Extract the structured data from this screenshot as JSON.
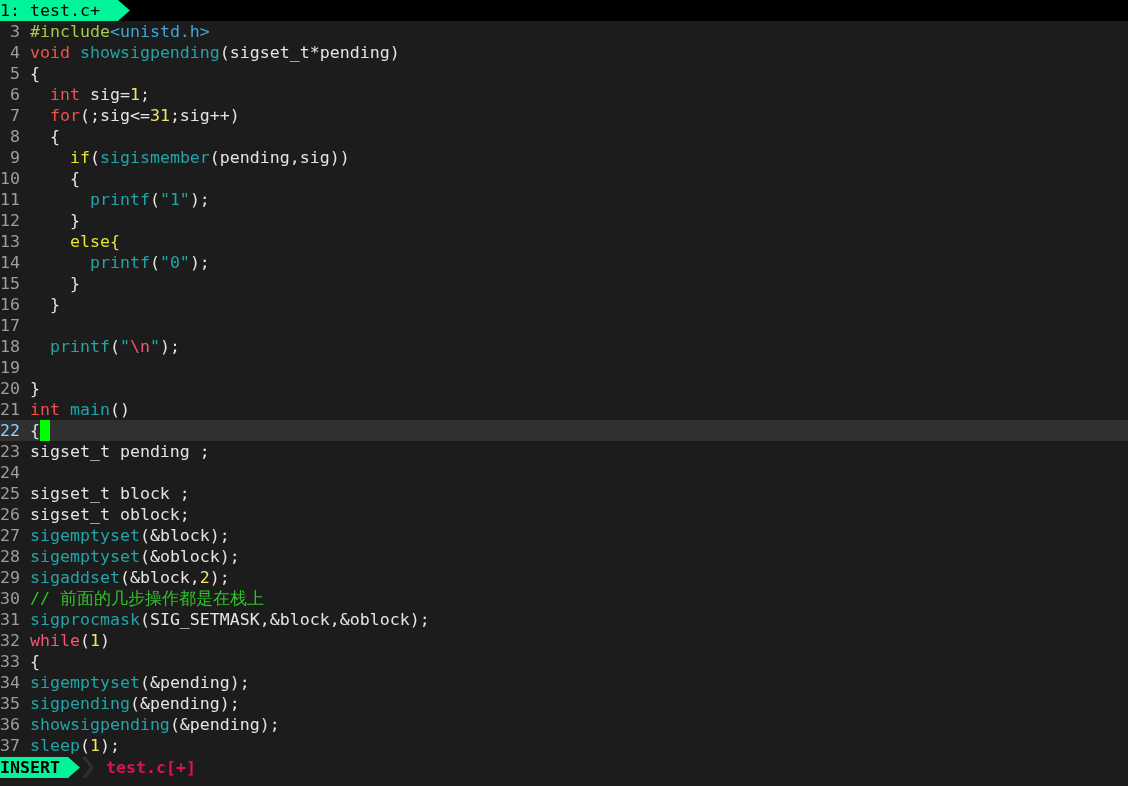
{
  "tabline": {
    "tabs": [
      {
        "label": "1: test.c+",
        "selected": true
      }
    ]
  },
  "lines": [
    {
      "number": "3",
      "current": false,
      "segments": [
        {
          "kind": "preproc",
          "text": "#include"
        },
        {
          "kind": "include",
          "text": "<unistd.h>"
        }
      ]
    },
    {
      "number": "4",
      "current": false,
      "segments": [
        {
          "kind": "type",
          "text": "void "
        },
        {
          "kind": "func",
          "text": "showsigpending"
        },
        {
          "kind": "plain",
          "text": "(sigset_t*pending)"
        }
      ]
    },
    {
      "number": "5",
      "current": false,
      "segments": [
        {
          "kind": "plain",
          "text": "{"
        }
      ]
    },
    {
      "number": "6",
      "current": false,
      "segments": [
        {
          "kind": "type",
          "text": "  int"
        },
        {
          "kind": "plain",
          "text": " sig="
        },
        {
          "kind": "number",
          "text": "1"
        },
        {
          "kind": "plain",
          "text": ";"
        }
      ]
    },
    {
      "number": "7",
      "current": false,
      "segments": [
        {
          "kind": "statement",
          "text": "  for"
        },
        {
          "kind": "plain",
          "text": "(;sig<="
        },
        {
          "kind": "number",
          "text": "31"
        },
        {
          "kind": "plain",
          "text": ";sig++)"
        }
      ]
    },
    {
      "number": "8",
      "current": false,
      "segments": [
        {
          "kind": "plain",
          "text": "  {"
        }
      ]
    },
    {
      "number": "9",
      "current": false,
      "segments": [
        {
          "kind": "conditional",
          "text": "    if"
        },
        {
          "kind": "plain",
          "text": "("
        },
        {
          "kind": "func",
          "text": "sigismember"
        },
        {
          "kind": "plain",
          "text": "(pending,sig))"
        }
      ]
    },
    {
      "number": "10",
      "current": false,
      "segments": [
        {
          "kind": "plain",
          "text": "    {"
        }
      ]
    },
    {
      "number": "11",
      "current": false,
      "segments": [
        {
          "kind": "func",
          "text": "      printf"
        },
        {
          "kind": "plain",
          "text": "("
        },
        {
          "kind": "string",
          "text": "\"1\""
        },
        {
          "kind": "plain",
          "text": ");"
        }
      ]
    },
    {
      "number": "12",
      "current": false,
      "segments": [
        {
          "kind": "plain",
          "text": "    }"
        }
      ]
    },
    {
      "number": "13",
      "current": false,
      "segments": [
        {
          "kind": "conditional",
          "text": "    else{"
        }
      ]
    },
    {
      "number": "14",
      "current": false,
      "segments": [
        {
          "kind": "func",
          "text": "      printf"
        },
        {
          "kind": "plain",
          "text": "("
        },
        {
          "kind": "string",
          "text": "\"0\""
        },
        {
          "kind": "plain",
          "text": ");"
        }
      ]
    },
    {
      "number": "15",
      "current": false,
      "segments": [
        {
          "kind": "plain",
          "text": "    }"
        }
      ]
    },
    {
      "number": "16",
      "current": false,
      "segments": [
        {
          "kind": "plain",
          "text": "  }"
        }
      ]
    },
    {
      "number": "17",
      "current": false
    },
    {
      "number": "18",
      "current": false,
      "segments": [
        {
          "kind": "func",
          "text": "  printf"
        },
        {
          "kind": "plain",
          "text": "("
        },
        {
          "kind": "string",
          "text": "\""
        },
        {
          "kind": "escape",
          "text": "\\n"
        },
        {
          "kind": "string",
          "text": "\""
        },
        {
          "kind": "plain",
          "text": ");"
        }
      ]
    },
    {
      "number": "19",
      "current": false
    },
    {
      "number": "20",
      "current": false,
      "segments": [
        {
          "kind": "plain",
          "text": "}"
        }
      ]
    },
    {
      "number": "21",
      "current": false,
      "segments": [
        {
          "kind": "type",
          "text": "int "
        },
        {
          "kind": "func",
          "text": "main"
        },
        {
          "kind": "plain",
          "text": "()"
        }
      ]
    },
    {
      "number": "22",
      "current": true,
      "segments": [
        {
          "kind": "plain",
          "text": "{"
        }
      ]
    },
    {
      "number": "23",
      "current": false,
      "segments": [
        {
          "kind": "plain",
          "text": "sigset_t pending ;"
        }
      ]
    },
    {
      "number": "24",
      "current": false
    },
    {
      "number": "25",
      "current": false,
      "segments": [
        {
          "kind": "plain",
          "text": "sigset_t block ;"
        }
      ]
    },
    {
      "number": "26",
      "current": false,
      "segments": [
        {
          "kind": "plain",
          "text": "sigset_t oblock;"
        }
      ]
    },
    {
      "number": "27",
      "current": false,
      "segments": [
        {
          "kind": "func",
          "text": "sigemptyset"
        },
        {
          "kind": "plain",
          "text": "(&block);"
        }
      ]
    },
    {
      "number": "28",
      "current": false,
      "segments": [
        {
          "kind": "func",
          "text": "sigemptyset"
        },
        {
          "kind": "plain",
          "text": "(&oblock);"
        }
      ]
    },
    {
      "number": "29",
      "current": false,
      "segments": [
        {
          "kind": "func",
          "text": "sigaddset"
        },
        {
          "kind": "plain",
          "text": "(&block,"
        },
        {
          "kind": "number",
          "text": "2"
        },
        {
          "kind": "plain",
          "text": ");"
        }
      ]
    },
    {
      "number": "30",
      "current": false,
      "segments": [
        {
          "kind": "comment",
          "text": "// 前面的几步操作都是在栈上"
        }
      ]
    },
    {
      "number": "31",
      "current": false,
      "segments": [
        {
          "kind": "func",
          "text": "sigprocmask"
        },
        {
          "kind": "plain",
          "text": "(SIG_SETMASK,&block,&oblock);"
        }
      ]
    },
    {
      "number": "32",
      "current": false,
      "segments": [
        {
          "kind": "repeat",
          "text": "while"
        },
        {
          "kind": "plain",
          "text": "("
        },
        {
          "kind": "number",
          "text": "1"
        },
        {
          "kind": "plain",
          "text": ")"
        }
      ]
    },
    {
      "number": "33",
      "current": false,
      "segments": [
        {
          "kind": "plain",
          "text": "{"
        }
      ]
    },
    {
      "number": "34",
      "current": false,
      "segments": [
        {
          "kind": "func",
          "text": "sigemptyset"
        },
        {
          "kind": "plain",
          "text": "(&pending);"
        }
      ]
    },
    {
      "number": "35",
      "current": false,
      "segments": [
        {
          "kind": "func",
          "text": "sigpending"
        },
        {
          "kind": "plain",
          "text": "(&pending);"
        }
      ]
    },
    {
      "number": "36",
      "current": false,
      "segments": [
        {
          "kind": "func",
          "text": "showsigpending"
        },
        {
          "kind": "plain",
          "text": "(&pending);"
        }
      ]
    },
    {
      "number": "37",
      "current": false,
      "segments": [
        {
          "kind": "func",
          "text": "sleep"
        },
        {
          "kind": "plain",
          "text": "("
        },
        {
          "kind": "number",
          "text": "1"
        },
        {
          "kind": "plain",
          "text": ");"
        }
      ]
    }
  ],
  "statusline": {
    "mode": "INSERT",
    "file": "test.c[+]"
  }
}
